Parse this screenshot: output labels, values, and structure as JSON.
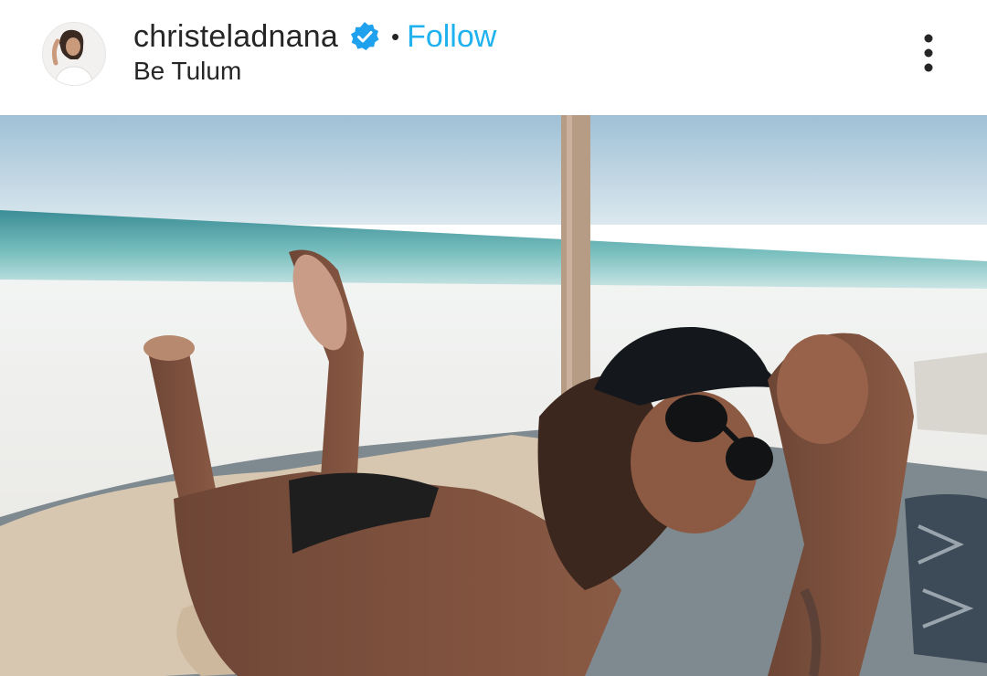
{
  "post_header": {
    "username": "christeladnana",
    "separator": "•",
    "follow_label": "Follow",
    "location": "Be Tulum",
    "verified_icon": "verified-badge-icon",
    "more_icon": "more-options-icon"
  },
  "colors": {
    "follow": "#1fb2ee",
    "verified": "#1fa1ee",
    "text": "#262626"
  },
  "photo": {
    "subject": "beach-photo"
  }
}
